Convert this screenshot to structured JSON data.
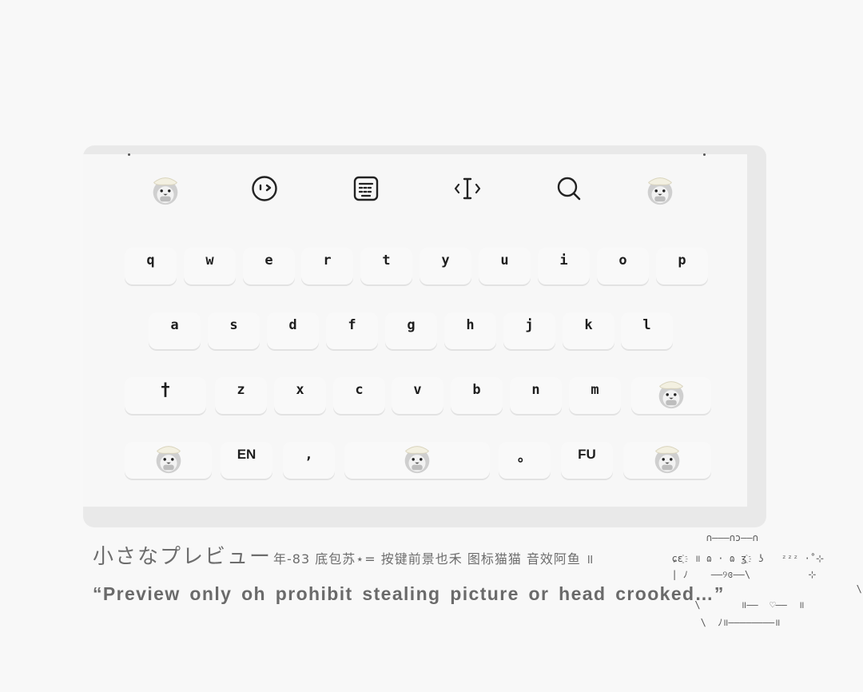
{
  "toolbar": {
    "items": [
      {
        "name": "mascot-left",
        "icon": "penguin-icon"
      },
      {
        "name": "emoji",
        "icon": "emoji-face-icon"
      },
      {
        "name": "clipboard",
        "icon": "keyboard-panel-icon"
      },
      {
        "name": "cursor",
        "icon": "text-cursor-icon"
      },
      {
        "name": "search",
        "icon": "search-icon"
      },
      {
        "name": "mascot-right",
        "icon": "penguin-icon"
      }
    ]
  },
  "keys": {
    "row1": [
      "q",
      "w",
      "e",
      "r",
      "t",
      "y",
      "u",
      "i",
      "o",
      "p"
    ],
    "row2": [
      "a",
      "s",
      "d",
      "f",
      "g",
      "h",
      "j",
      "k",
      "l"
    ],
    "row3": {
      "shift": "†",
      "letters": [
        "z",
        "x",
        "c",
        "v",
        "b",
        "n",
        "m"
      ]
    },
    "row4": {
      "lang": "EN",
      "comma": ",",
      "period": "。",
      "fu": "FU"
    }
  },
  "preview": {
    "title": "小さなプレビュー",
    "credits": "年-83 底包苏⋆= 按键前景也禾 图标猫猫 音效阿鱼 ॥",
    "subtitle": "“Preview only oh prohibit stealing picture or head crooked…”"
  },
  "ascii_art": {
    "line1": "        ∩———∩ɔ——∩",
    "line2": "  ɕɛ҈  ॥ ɷ · ɷ ʒ҈  ʖ   ᶻᶻᶻ ·˚⊹",
    "line3": "  | ﾉ    ——୨ɞ——\\          ⊹",
    "line4": "                                  \\",
    "line5": "      \\       ॥——  ♡——  ॥",
    "line6": "       \\  ﾉ॥————————॥"
  },
  "colors": {
    "background": "#f8f8f8",
    "keyboard": "#f7f7f7",
    "key": "#f9f9f9",
    "text": "#1c1c1c",
    "muted": "#6d6d6d"
  }
}
